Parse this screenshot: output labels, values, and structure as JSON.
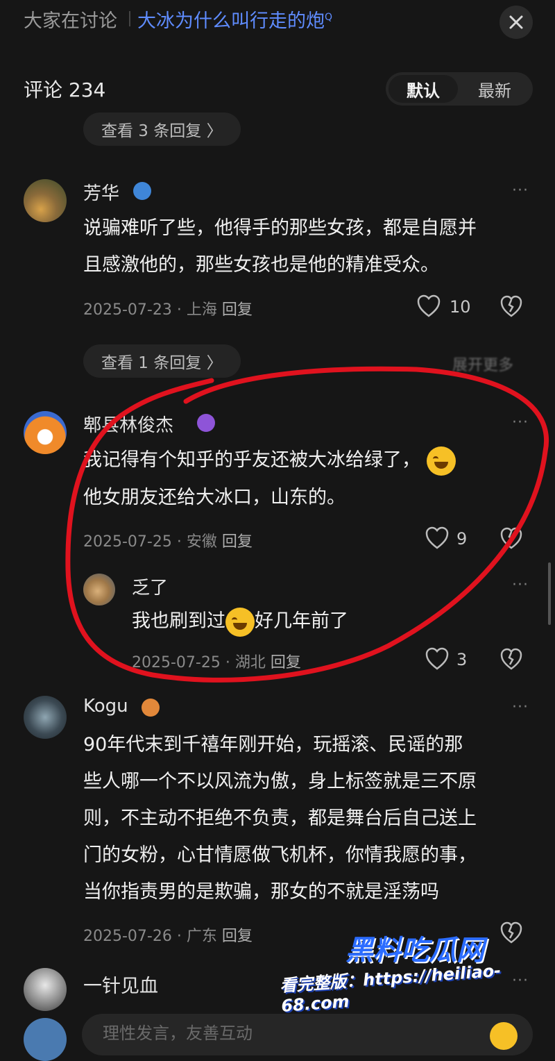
{
  "header": {
    "section_label": "大家在讨论",
    "topic": "大冰为什么叫行走的炮",
    "topic_suffix": "Q"
  },
  "comments_header": {
    "title": "评论 234",
    "sort_default": "默认",
    "sort_latest": "最新"
  },
  "top_pill": "查看 3 条回复 〉",
  "comments": [
    {
      "user": "芳华",
      "badge_color": "#4a90e2",
      "line1": "说骗难听了些，他得手的那些女孩，都是自愿并",
      "line2": "且感激他的，那些女孩也是他的精准受众。",
      "date": "2025-07-23",
      "location": "上海",
      "reply_label": "回复",
      "likes": "10",
      "more": "···"
    },
    {
      "user": "郫县林俊杰",
      "badge_color": "#9b5de5",
      "line1": "我记得有个知乎的乎友还被大冰给绿了，",
      "line2": "他女朋友还给大冰口，山东的。",
      "date": "2025-07-25",
      "location": "安徽",
      "reply_label": "回复",
      "likes": "9",
      "more": "···"
    },
    {
      "user": "乏了",
      "line1a": "我也刷到过",
      "line1b": "好几年前了",
      "date": "2025-07-25",
      "location": "湖北",
      "reply_label": "回复",
      "likes": "3",
      "more": "···"
    },
    {
      "user": "Kogu",
      "badge_color": "#e07a2b",
      "lines": [
        "90年代末到千禧年刚开始，玩摇滚、民谣的那",
        "些人哪一个不以风流为傲，身上标签就是三不原",
        "则，不主动不拒绝不负责，都是舞台后自己送上",
        "门的女粉，心甘情愿做飞机杯，你情我愿的事，",
        "当你指责男的是欺骗，那女的不就是淫荡吗"
      ],
      "date": "2025-07-26",
      "location": "广东",
      "reply_label": "回复",
      "more": "···"
    },
    {
      "line1": "一针见血",
      "more": "···"
    }
  ],
  "mid_pill": "查看 1 条回复 〉",
  "mid_right_blurred": "展开更多",
  "separator": "·",
  "input_placeholder": "理性发言，友善互动",
  "watermark": {
    "brand": "黑料吃瓜网",
    "url": "看完整版：https://heiliao-68.com"
  },
  "colors": {
    "background": "#161616",
    "topic_link": "#5f8cff",
    "annotation_circle": "#e0121e"
  }
}
